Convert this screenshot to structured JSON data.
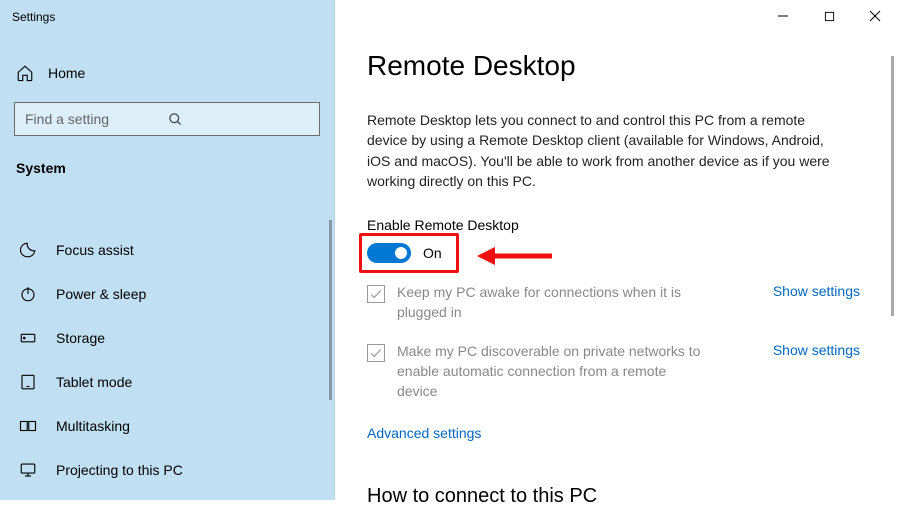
{
  "window_title": "Settings",
  "sidebar": {
    "home_label": "Home",
    "search_placeholder": "Find a setting",
    "section_label": "System",
    "items": [
      {
        "label": "Focus assist"
      },
      {
        "label": "Power & sleep"
      },
      {
        "label": "Storage"
      },
      {
        "label": "Tablet mode"
      },
      {
        "label": "Multitasking"
      },
      {
        "label": "Projecting to this PC"
      }
    ]
  },
  "main": {
    "page_title": "Remote Desktop",
    "description": "Remote Desktop lets you connect to and control this PC from a remote device by using a Remote Desktop client (available for Windows, Android, iOS and macOS). You'll be able to work from another device as if you were working directly on this PC.",
    "enable_label": "Enable Remote Desktop",
    "toggle_state": "On",
    "options": [
      {
        "text": "Keep my PC awake for connections when it is plugged in",
        "link": "Show settings"
      },
      {
        "text": "Make my PC discoverable on private networks to enable automatic connection from a remote device",
        "link": "Show settings"
      }
    ],
    "advanced_link": "Advanced settings",
    "connect_heading": "How to connect to this PC"
  }
}
